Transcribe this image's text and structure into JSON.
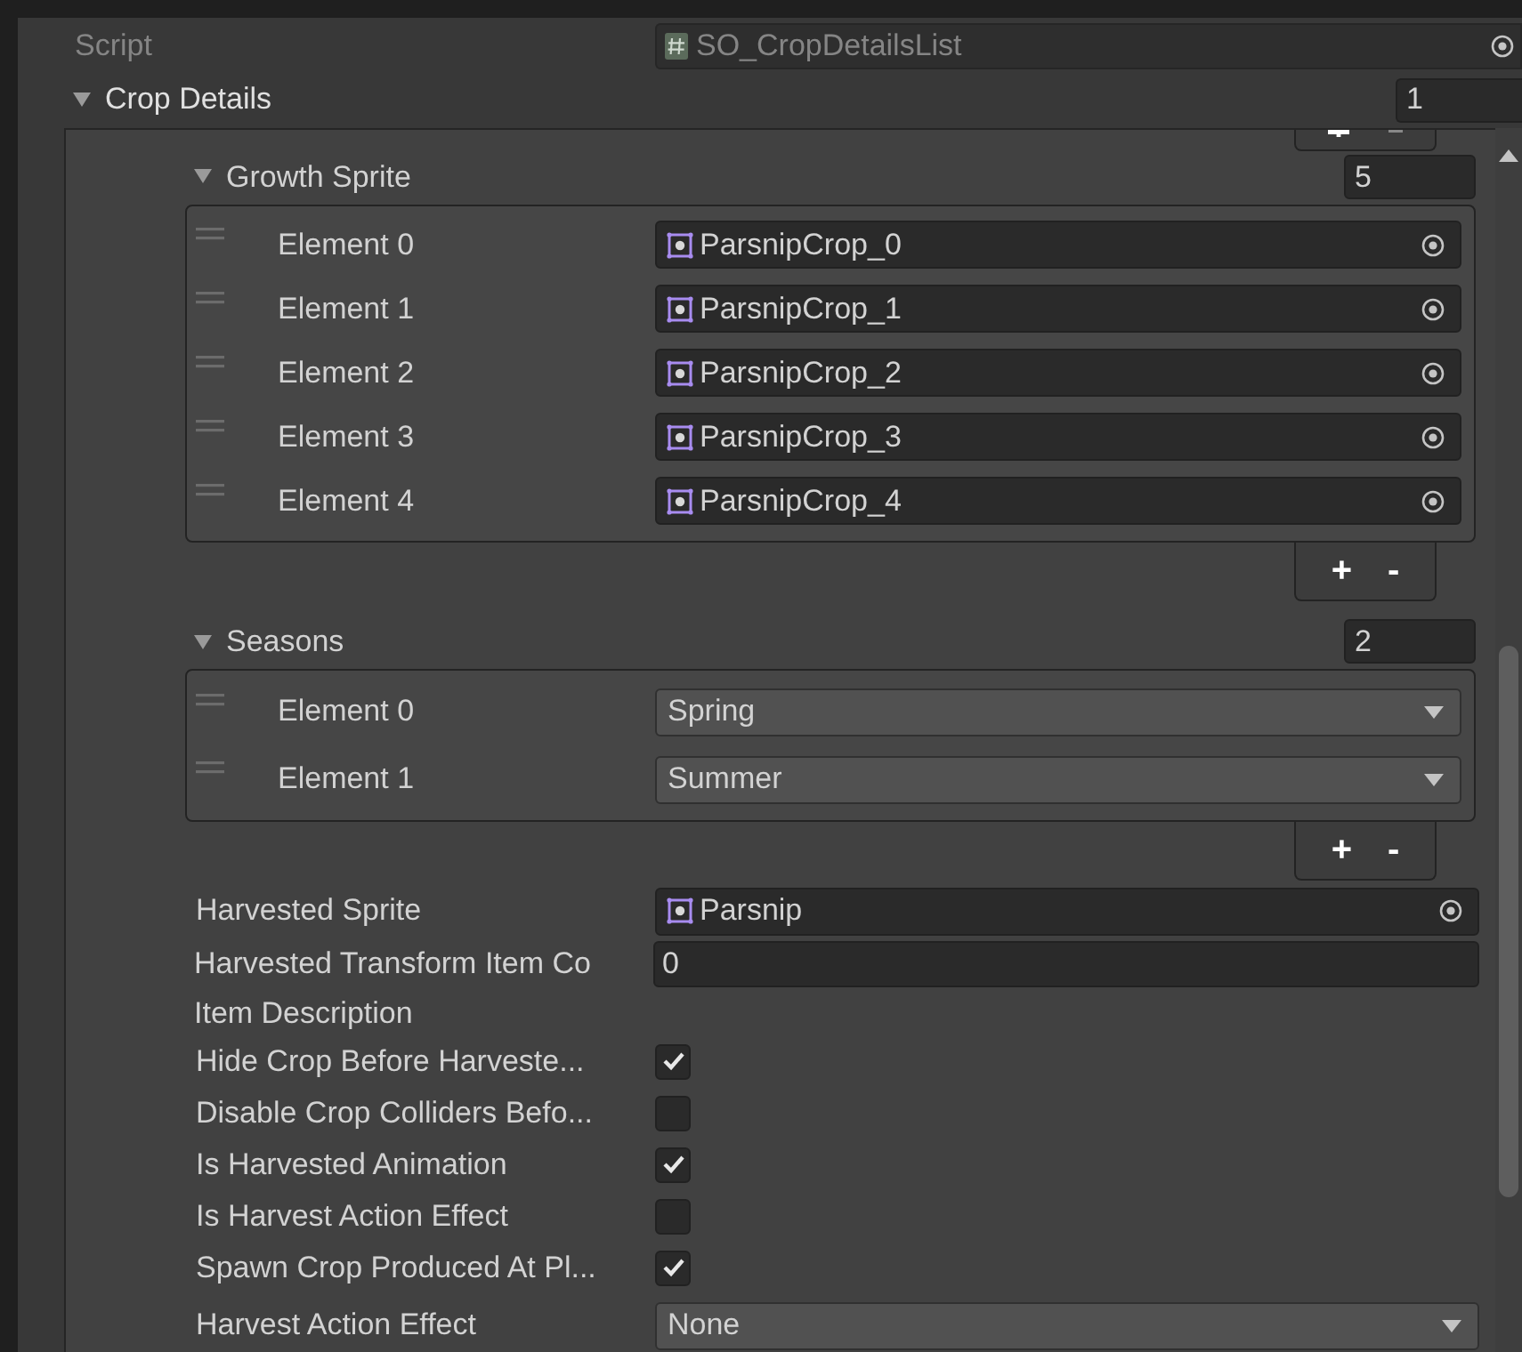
{
  "script": {
    "label": "Script",
    "value": "SO_CropDetailsList",
    "disabled": true
  },
  "crop_details": {
    "label": "Crop Details",
    "expanded": true,
    "count": "1",
    "growth_sprite": {
      "label": "Growth Sprite",
      "expanded": true,
      "count": "5",
      "elements": [
        {
          "label": "Element 0",
          "value": "ParsnipCrop_0"
        },
        {
          "label": "Element 1",
          "value": "ParsnipCrop_1"
        },
        {
          "label": "Element 2",
          "value": "ParsnipCrop_2"
        },
        {
          "label": "Element 3",
          "value": "ParsnipCrop_3"
        },
        {
          "label": "Element 4",
          "value": "ParsnipCrop_4"
        }
      ],
      "add": "+",
      "remove": "-"
    },
    "seasons": {
      "label": "Seasons",
      "expanded": true,
      "count": "2",
      "elements": [
        {
          "label": "Element 0",
          "value": "Spring"
        },
        {
          "label": "Element 1",
          "value": "Summer"
        }
      ],
      "add": "+",
      "remove": "-"
    },
    "properties": [
      {
        "kind": "object",
        "label": "Harvested Sprite",
        "value": "Parsnip"
      },
      {
        "kind": "number",
        "label": "Harvested Transform Item Co",
        "value": "0"
      },
      {
        "kind": "header",
        "label": "Item Description"
      },
      {
        "kind": "toggle",
        "label": "Hide Crop Before Harveste...",
        "checked": true
      },
      {
        "kind": "toggle",
        "label": "Disable Crop Colliders Befo...",
        "checked": false
      },
      {
        "kind": "toggle",
        "label": "Is Harvested Animation",
        "checked": true
      },
      {
        "kind": "toggle",
        "label": "Is Harvest Action Effect",
        "checked": false
      },
      {
        "kind": "toggle",
        "label": "Spawn Crop Produced At Pl...",
        "checked": true
      },
      {
        "kind": "enum",
        "label": "Harvest Action Effect",
        "value": "None"
      }
    ]
  }
}
